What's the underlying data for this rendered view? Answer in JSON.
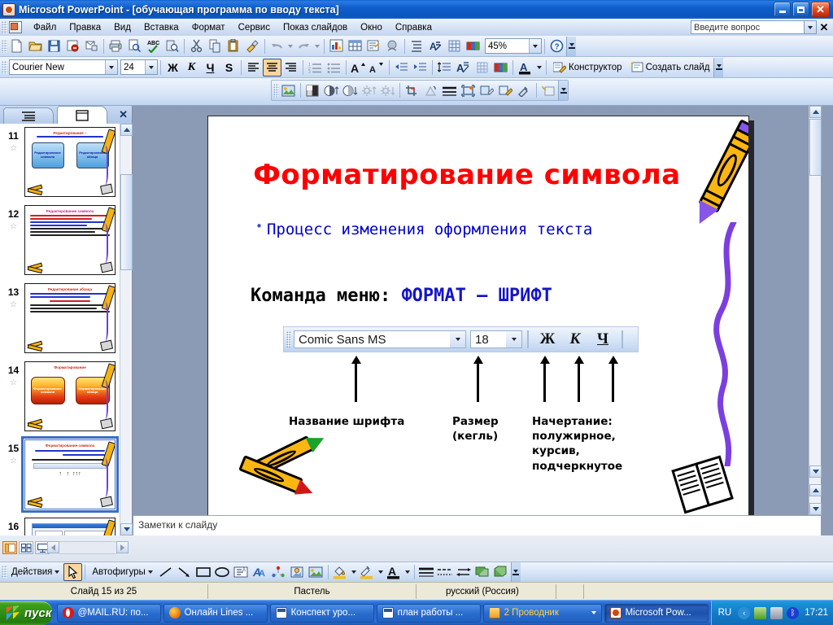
{
  "window": {
    "app_title": "Microsoft PowerPoint - [обучающая программа по вводу текста]",
    "app_icon": "powerpoint-icon",
    "minimize_label": "_",
    "restore_label": "□",
    "close_label": "✕"
  },
  "menu": {
    "items": [
      {
        "label": "Файл"
      },
      {
        "label": "Правка"
      },
      {
        "label": "Вид"
      },
      {
        "label": "Вставка"
      },
      {
        "label": "Формат"
      },
      {
        "label": "Сервис"
      },
      {
        "label": "Показ слайдов"
      },
      {
        "label": "Окно"
      },
      {
        "label": "Справка"
      }
    ],
    "ask_placeholder": "Введите вопрос",
    "ask_value": "",
    "close_label": "✕"
  },
  "standard_toolbar": {
    "buttons": [
      {
        "name": "new-icon"
      },
      {
        "name": "open-icon"
      },
      {
        "name": "save-icon"
      },
      {
        "name": "permission-icon"
      },
      {
        "name": "email-icon"
      },
      {
        "name": "print-icon"
      },
      {
        "name": "print-preview-icon"
      },
      {
        "name": "spelling-icon"
      },
      {
        "name": "research-icon"
      },
      {
        "name": "cut-icon"
      },
      {
        "name": "copy-icon"
      },
      {
        "name": "paste-icon"
      },
      {
        "name": "format-painter-icon"
      },
      {
        "name": "undo-icon"
      },
      {
        "name": "redo-icon"
      },
      {
        "name": "insert-chart-icon"
      },
      {
        "name": "insert-table-icon"
      },
      {
        "name": "insert-diagram-icon"
      },
      {
        "name": "insert-hyperlink-icon"
      },
      {
        "name": "expand-all-icon"
      },
      {
        "name": "show-formatting-icon"
      },
      {
        "name": "grid-icon"
      },
      {
        "name": "color-scheme-icon"
      }
    ],
    "zoom_value": "45%",
    "help_icon": "help-icon"
  },
  "formatting_toolbar": {
    "font_name": "Courier New",
    "font_size": "24",
    "bold_label": "Ж",
    "italic_label": "К",
    "underline_label": "Ч",
    "shadow_label": "S",
    "align_left": "align-left-icon",
    "align_center": "align-center-icon",
    "align_right": "align-right-icon",
    "numbering": "numbered-list-icon",
    "bullets": "bulleted-list-icon",
    "grow_font": "increase-font-icon",
    "shrink_font": "decrease-font-icon",
    "decrease_indent": "decrease-indent-icon",
    "increase_indent": "increase-indent-icon",
    "line_spacing": "line-spacing-icon",
    "font_color": "font-color-icon",
    "design_label": "Конструктор",
    "new_slide_label": "Создать слайд"
  },
  "picture_toolbar": {
    "buttons": [
      {
        "name": "insert-picture-icon"
      },
      {
        "name": "color-icon"
      },
      {
        "name": "more-contrast-icon"
      },
      {
        "name": "less-contrast-icon"
      },
      {
        "name": "more-brightness-icon"
      },
      {
        "name": "less-brightness-icon"
      },
      {
        "name": "crop-icon"
      },
      {
        "name": "rotate-left-icon"
      },
      {
        "name": "line-style-icon"
      },
      {
        "name": "compress-pictures-icon"
      },
      {
        "name": "recolor-picture-icon"
      },
      {
        "name": "format-picture-icon"
      },
      {
        "name": "set-transparent-color-icon"
      },
      {
        "name": "reset-picture-icon"
      }
    ]
  },
  "slide_pane": {
    "tab_outline": "outline-tab-icon",
    "tab_slides": "slides-tab-icon",
    "close_label": "✕",
    "thumbnails": [
      {
        "number": "11",
        "title": "Редактирование  –",
        "subtitle": "процесс внесения изменений",
        "shapes": [
          "Редактирование символа",
          "Редактирование абзаца"
        ],
        "selected": false
      },
      {
        "number": "12",
        "title": "Редактирование символа",
        "selected": false
      },
      {
        "number": "13",
        "title": "Редактирование абзаца",
        "selected": false
      },
      {
        "number": "14",
        "title": "Форматирование",
        "shapes": [
          "Форматирование символа",
          "Форматирование абзаца"
        ],
        "selected": false
      },
      {
        "number": "15",
        "title": "Форматирование символа",
        "selected": true
      },
      {
        "number": "16",
        "title": "",
        "selected": false
      }
    ]
  },
  "slide": {
    "title": "Форматирование символа",
    "bullet_text": "Процесс изменения оформления текста",
    "bullet_marker": "•",
    "command_prefix": "Команда меню: ",
    "command_highlight": "ФОРМАТ – ШРИФТ",
    "fontbar": {
      "font_name": "Comic Sans MS",
      "font_size": "18",
      "bold_label": "Ж",
      "italic_label": "К",
      "underline_label": "Ч"
    },
    "annotations": [
      {
        "lines": [
          "Название шрифта"
        ]
      },
      {
        "lines": [
          "Размер",
          "(кегль)"
        ]
      },
      {
        "lines": [
          "Начертание:",
          "полужирное,",
          "курсив,",
          "подчеркнутое"
        ]
      }
    ],
    "decorations": [
      "crayon-purple",
      "crayon-pair",
      "notebook",
      "purple-squiggle"
    ]
  },
  "notes": {
    "placeholder": "Заметки к слайду"
  },
  "view_buttons": [
    {
      "name": "normal-view-button",
      "active": true
    },
    {
      "name": "slide-sorter-view-button",
      "active": false
    },
    {
      "name": "slide-show-button",
      "active": false
    }
  ],
  "drawing_toolbar": {
    "actions_label": "Действия",
    "autoshapes_label": "Автофигуры",
    "buttons": [
      {
        "name": "select-objects-icon"
      },
      {
        "name": "line-icon"
      },
      {
        "name": "arrow-icon"
      },
      {
        "name": "rectangle-icon"
      },
      {
        "name": "oval-icon"
      },
      {
        "name": "text-box-icon"
      },
      {
        "name": "wordart-icon"
      },
      {
        "name": "diagram-icon"
      },
      {
        "name": "clipart-icon"
      },
      {
        "name": "picture-icon"
      },
      {
        "name": "fill-color-icon"
      },
      {
        "name": "line-color-icon"
      },
      {
        "name": "font-color-icon"
      },
      {
        "name": "line-style-icon"
      },
      {
        "name": "dash-style-icon"
      },
      {
        "name": "arrow-style-icon"
      },
      {
        "name": "shadow-style-icon"
      },
      {
        "name": "3d-style-icon"
      }
    ]
  },
  "status_bar": {
    "slide_counter": "Слайд 15 из 25",
    "design_name": "Пастель",
    "language": "русский (Россия)"
  },
  "taskbar": {
    "start_label": "пуск",
    "items": [
      {
        "label": "@MAIL.RU: по...",
        "icon": "opera-icon",
        "color": "#d81a1a",
        "active": false
      },
      {
        "label": "Онлайн Lines ...",
        "icon": "firefox-icon",
        "color": "#e8730a",
        "active": false
      },
      {
        "label": "Конспект уро...",
        "icon": "word-icon",
        "color": "#2a5699",
        "active": false
      },
      {
        "label": "план работы ...",
        "icon": "word-icon",
        "color": "#2a5699",
        "active": false
      },
      {
        "label": "2 Проводник",
        "icon": "folder-icon",
        "color": "#f0b840",
        "active": false,
        "has_arrow": true
      },
      {
        "label": "Microsoft Pow...",
        "icon": "powerpoint-icon",
        "color": "#d2490a",
        "active": true
      }
    ],
    "lang_indicator": "RU",
    "tray_icons": [
      "show-hidden-icon",
      "network-icon",
      "system-icon",
      "bluetooth-icon"
    ],
    "clock": "17:21"
  },
  "colors": {
    "title_red": "#ff0000",
    "bullet_blue": "#0000cc",
    "highlight_blue": "#1414c8",
    "crayon_orange": "#fbb612",
    "crayon_purple": "#8656e8",
    "xp_blue": "#2463c9",
    "selection_blue": "#3b6ec4"
  }
}
